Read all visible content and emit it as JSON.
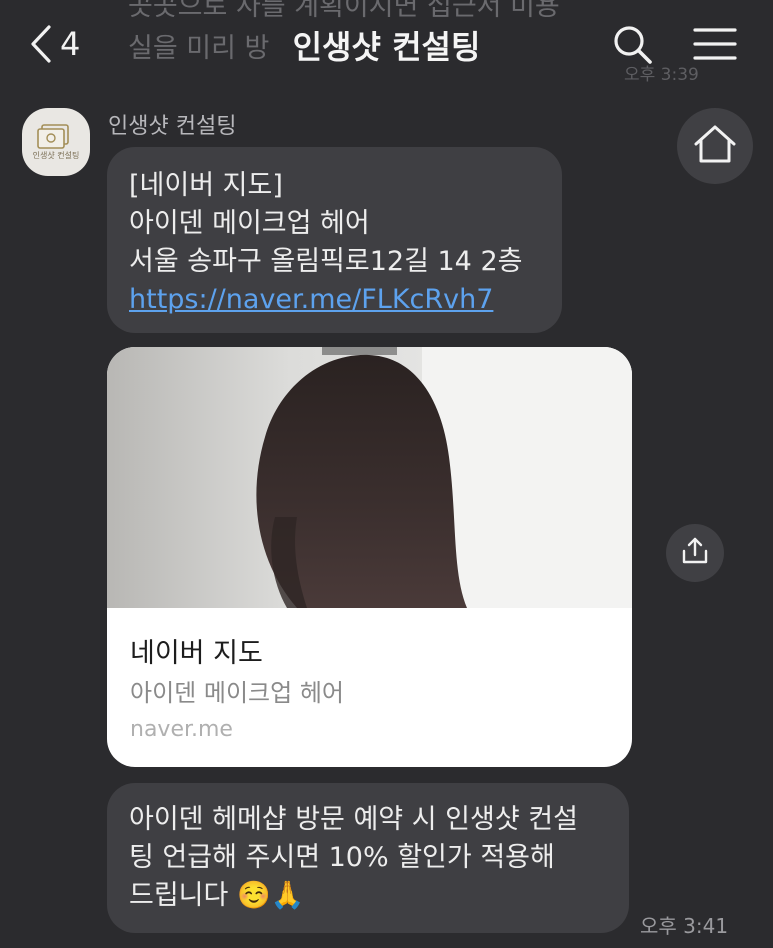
{
  "background_messages": {
    "line1": "곳곳으로 사를 계획이시면 접근서 미용",
    "line2": "실을 미리 방",
    "time": "오후 3:39"
  },
  "header": {
    "back_count": "4",
    "title": "인생샷 컨설팅"
  },
  "sender": {
    "name": "인생샷 컨설팅",
    "avatar_text": "인생샷 컨설팅"
  },
  "messages": {
    "msg1": {
      "line1": "[네이버 지도]",
      "line2": "아이덴 메이크업 헤어",
      "line3": "서울 송파구 올림픽로12길 14 2층",
      "link": "https://naver.me/FLKcRvh7"
    },
    "card": {
      "title": "네이버 지도",
      "subtitle": "아이덴 메이크업 헤어",
      "domain": "naver.me"
    },
    "msg3": {
      "line1": "아이덴 헤메샵 방문 예약 시 인생샷 컨설",
      "line2": "팅 언급해 주시면 10% 할인가 적용해",
      "line3": "드립니다 ☺️🙏",
      "time": "오후 3:41"
    }
  },
  "colors": {
    "background": "#2b2b2e",
    "bubble": "#3f3f43",
    "link": "#5da2ee"
  },
  "icons": [
    "chevron-left-icon",
    "search-icon",
    "menu-icon",
    "home-icon",
    "share-icon"
  ]
}
